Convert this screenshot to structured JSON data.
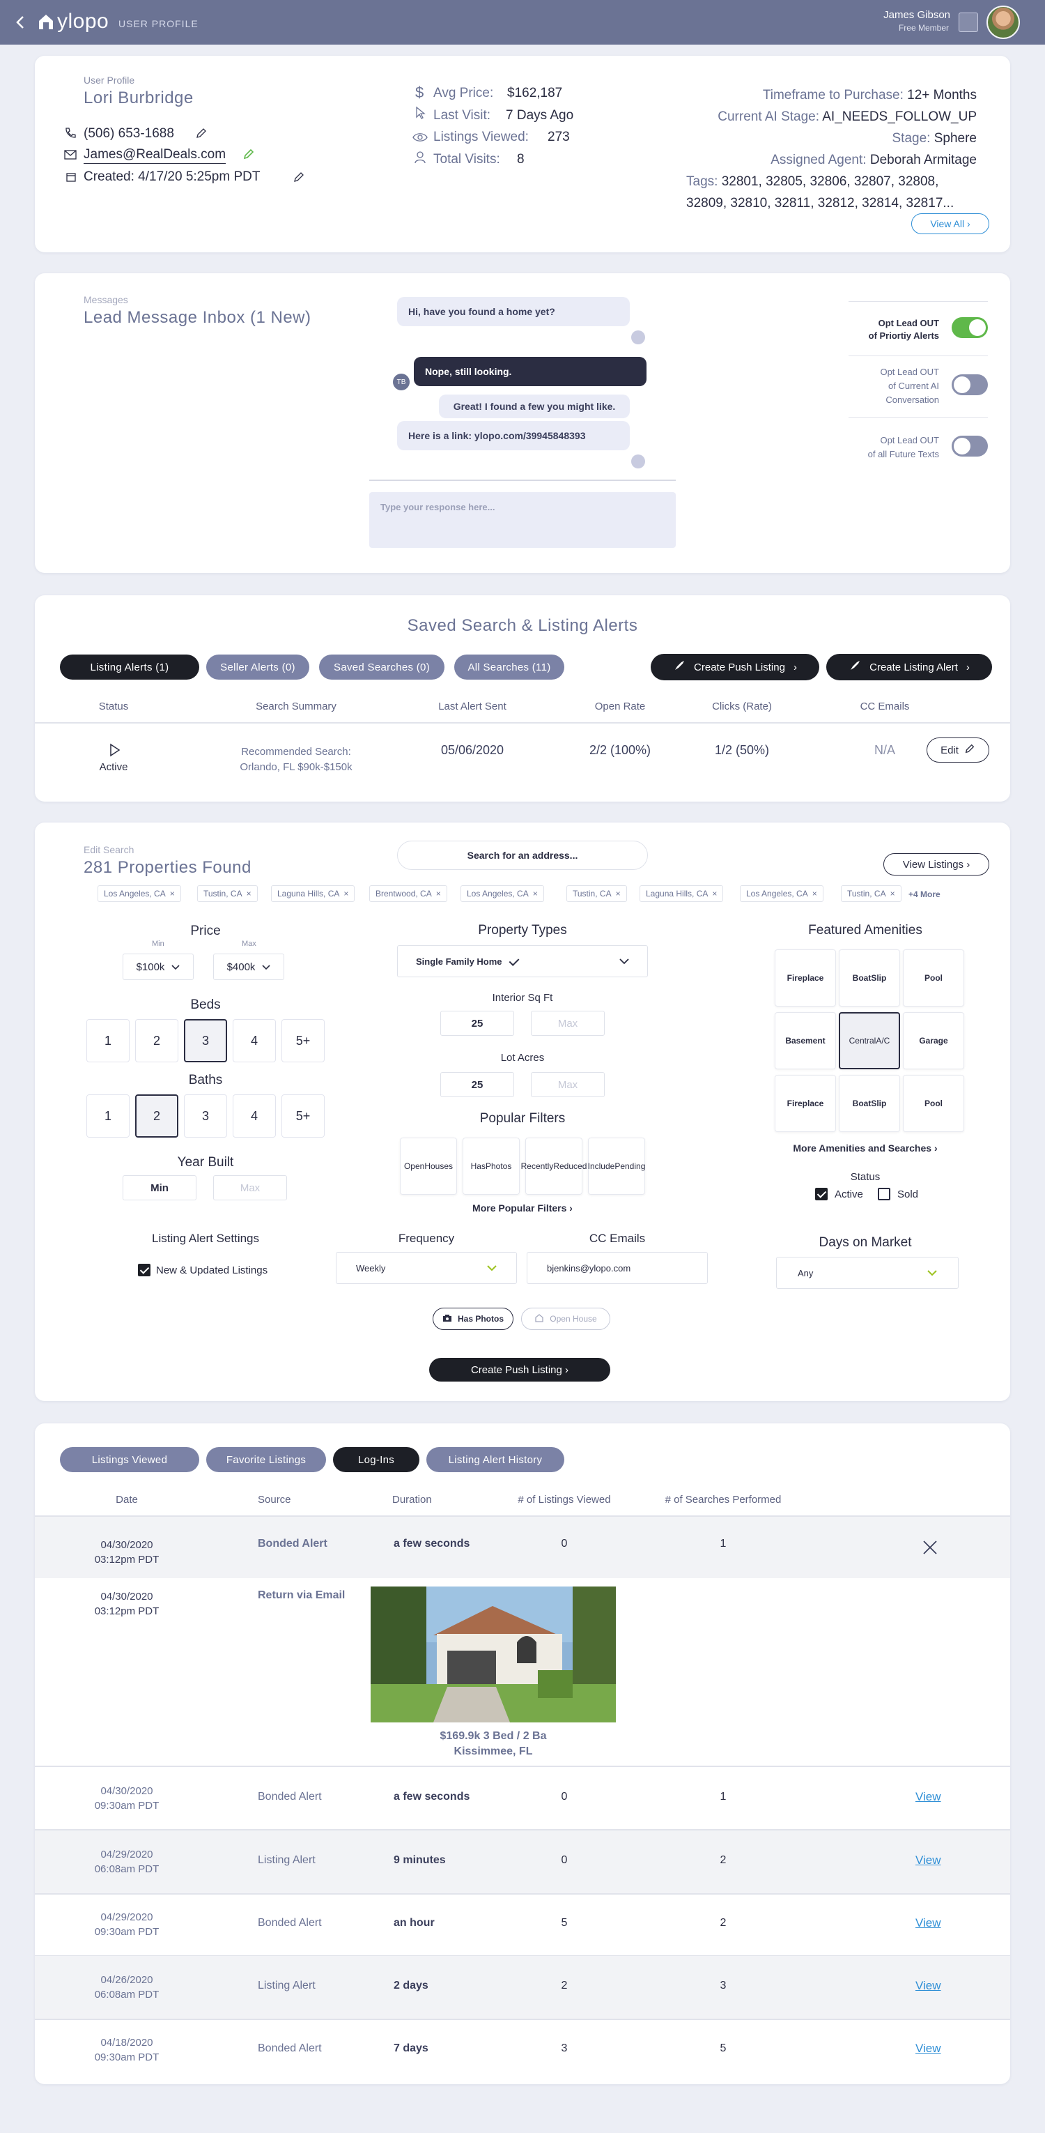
{
  "header": {
    "logo": "ylopo",
    "section": "USER PROFILE",
    "user_name": "James Gibson",
    "user_tier": "Free Member"
  },
  "profile": {
    "label": "User Profile",
    "name": "Lori Burbridge",
    "phone": "(506) 653-1688",
    "email": "James@RealDeals.com",
    "created": "Created: 4/17/20 5:25pm PDT",
    "avg_price_label": "Avg Price:",
    "avg_price": "$162,187",
    "last_visit_label": "Last Visit:",
    "last_visit": "7 Days Ago",
    "listings_viewed_label": "Listings Viewed:",
    "listings_viewed": "273",
    "total_visits_label": "Total Visits:",
    "total_visits": "8",
    "timeframe_label": "Timeframe to Purchase:",
    "timeframe": "12+ Months",
    "ai_stage_label": "Current AI Stage:",
    "ai_stage": "AI_NEEDS_FOLLOW_UP",
    "stage_label": "Stage:",
    "stage": "Sphere",
    "agent_label": "Assigned Agent:",
    "agent": "Deborah Armitage",
    "tags_label": "Tags:",
    "tags_line1": "32801, 32805, 32806, 32807, 32808,",
    "tags_line2": "32809, 32810, 32811, 32812, 32814, 32817...",
    "view_all": "View All ›"
  },
  "messages": {
    "label": "Messages",
    "title": "Lead Message Inbox (1 New)",
    "thread": [
      {
        "text": "Hi, have you found a home yet?"
      },
      {
        "text": "Nope, still looking.",
        "initials": "TB"
      },
      {
        "text": "Great! I found a few you might like."
      },
      {
        "text": "Here is a link: ylopo.com/39945848393"
      }
    ],
    "reply_placeholder": "Type your response here...",
    "opt_alerts": "Opt Lead OUT of Priortiy Alerts",
    "opt_ai_line1": "Opt Lead OUT",
    "opt_ai_line2": "of Current AI",
    "opt_ai_line3": "Conversation",
    "opt_texts_line1": "Opt Lead OUT",
    "opt_texts_line2": "of all Future Texts",
    "opt_alerts_line1": "Opt Lead OUT",
    "opt_alerts_line2": "of Priortiy Alerts",
    "toggles": {
      "alerts": true,
      "ai": false,
      "texts": false
    }
  },
  "saved": {
    "title": "Saved Search & Listing Alerts",
    "tabs": [
      "Listing Alerts (1)",
      "Seller Alerts (0)",
      "Saved Searches (0)",
      "All Searches (11)"
    ],
    "create_push": "Create Push Listing",
    "create_alert": "Create Listing Alert",
    "columns": [
      "Status",
      "Search Summary",
      "Last Alert Sent",
      "Open Rate",
      "Clicks (Rate)",
      "CC Emails"
    ],
    "row": {
      "status": "Active",
      "summary_line1": "Recommended Search:",
      "summary_line2": "Orlando, FL $90k-$150k",
      "last_alert": "05/06/2020",
      "open_rate": "2/2 (100%)",
      "clicks": "1/2 (50%)",
      "cc": "N/A",
      "edit": "Edit"
    }
  },
  "edit": {
    "label": "Edit Search",
    "found": "281 Properties Found",
    "search_placeholder": "Search for an address...",
    "view_listings": "View Listings ›",
    "chips": [
      "Los Angeles, CA",
      "Tustin, CA",
      "Laguna Hills, CA",
      "Brentwood, CA",
      "Los Angeles, CA",
      "Tustin, CA",
      "Laguna Hills, CA",
      "Los Angeles, CA",
      "Tustin, CA"
    ],
    "more_chips": "+4 More",
    "price_title": "Price",
    "price_min_label": "Min",
    "price_max_label": "Max",
    "price_min": "$100k",
    "price_max": "$400k",
    "beds_title": "Beds",
    "baths_title": "Baths",
    "options": [
      "1",
      "2",
      "3",
      "4",
      "5+"
    ],
    "beds_selected": "3",
    "baths_selected": "2",
    "year_title": "Year Built",
    "year_min": "Min",
    "year_max": "Max",
    "ptype_title": "Property Types",
    "ptype_value": "Single Family Home",
    "sqft_title": "Interior Sq Ft",
    "sqft_min": "25",
    "sqft_max": "Max",
    "lot_title": "Lot Acres",
    "lot_min": "25",
    "lot_max": "Max",
    "popular_title": "Popular Filters",
    "popular": [
      [
        "Open",
        "Houses"
      ],
      [
        "Has",
        "Photos"
      ],
      [
        "Recently",
        "Reduced"
      ],
      [
        "Include",
        "Pending"
      ]
    ],
    "more_popular": "More Popular Filters ›",
    "amen_title": "Featured Amenities",
    "amenities": [
      [
        "Fireplace"
      ],
      [
        "Boat",
        "Slip"
      ],
      [
        "Pool"
      ],
      [
        "Basement"
      ],
      [
        "Central",
        "A/C"
      ],
      [
        "Garage"
      ],
      [
        "Fireplace"
      ],
      [
        "Boat",
        "Slip"
      ],
      [
        "Pool"
      ]
    ],
    "amen_selected_index": 4,
    "more_amen": "More Amenities and Searches ›",
    "status_title": "Status",
    "status_active": "Active",
    "status_sold": "Sold",
    "alert_settings_title": "Listing Alert Settings",
    "new_updated": "New & Updated Listings",
    "frequency_title": "Frequency",
    "frequency": "Weekly",
    "cc_title": "CC Emails",
    "cc_value": "bjenkins@ylopo.com",
    "dom_title": "Days on Market",
    "dom_value": "Any",
    "has_photos": "Has Photos",
    "open_house": "Open House",
    "create_push": "Create Push Listing ›"
  },
  "activity": {
    "tabs": [
      "Listings Viewed",
      "Favorite Listings",
      "Log-Ins",
      "Listing Alert History"
    ],
    "active_tab": 2,
    "columns": [
      "Date",
      "Source",
      "Duration",
      "# of Listings Viewed",
      "# of Searches Performed"
    ],
    "rows": [
      {
        "date": "04/30/2020",
        "time": "03:12pm PDT",
        "source": "Bonded Alert",
        "duration": "a few seconds",
        "viewed": "0",
        "searches": "1"
      },
      {
        "date": "04/30/2020",
        "time": "03:12pm PDT",
        "source": "Return via Email",
        "listing_price": "$169.9k 3 Bed / 2 Ba",
        "listing_city": "Kissimmee, FL"
      },
      {
        "date": "04/30/2020",
        "time": "09:30am PDT",
        "source": "Bonded Alert",
        "duration": "a few seconds",
        "viewed": "0",
        "searches": "1",
        "action": "View"
      },
      {
        "date": "04/29/2020",
        "time": "06:08am PDT",
        "source": "Listing Alert",
        "duration": "9 minutes",
        "viewed": "0",
        "searches": "2",
        "action": "View"
      },
      {
        "date": "04/29/2020",
        "time": "09:30am PDT",
        "source": "Bonded Alert",
        "duration": "an hour",
        "viewed": "5",
        "searches": "2",
        "action": "View"
      },
      {
        "date": "04/26/2020",
        "time": "06:08am PDT",
        "source": "Listing Alert",
        "duration": "2 days",
        "viewed": "2",
        "searches": "3",
        "action": "View"
      },
      {
        "date": "04/18/2020",
        "time": "09:30am PDT",
        "source": "Bonded Alert",
        "duration": "7 days",
        "viewed": "3",
        "searches": "5",
        "action": "View"
      }
    ]
  },
  "colors": {
    "topbar": "#6b7394",
    "accent": "#2f8fd6",
    "toggle_on": "#5fb84a",
    "dark": "#1d1f26"
  }
}
